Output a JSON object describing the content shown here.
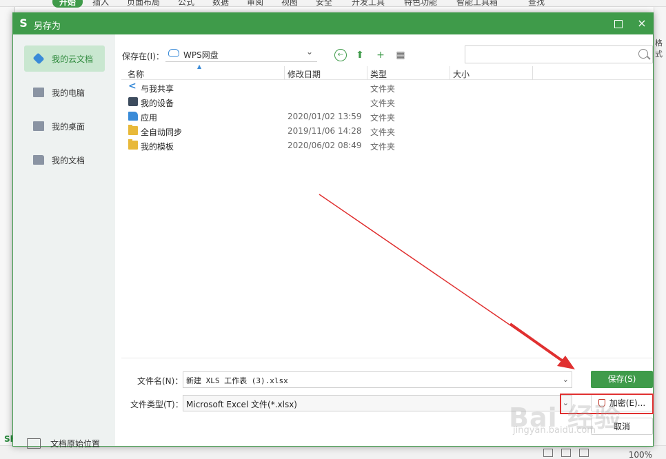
{
  "app": {
    "tabs": [
      "开始",
      "插入",
      "页面布局",
      "公式",
      "数据",
      "审阅",
      "视图",
      "安全",
      "开发工具",
      "特色功能",
      "智能工具箱",
      "查找"
    ],
    "sheet_tab": "Sh",
    "side_label": "格式",
    "zoom": "100%"
  },
  "dialog": {
    "title": "另存为",
    "logo": "S",
    "close": "×",
    "accent_color": "#3f9b4a"
  },
  "sidebar": {
    "items": [
      {
        "label": "我的云文档",
        "icon": "cloud-doc-icon",
        "active": true
      },
      {
        "label": "我的电脑",
        "icon": "computer-icon",
        "active": false
      },
      {
        "label": "我的桌面",
        "icon": "desktop-icon",
        "active": false
      },
      {
        "label": "我的文档",
        "icon": "folder-icon",
        "active": false
      }
    ],
    "bottom": {
      "label": "文档原始位置",
      "icon": "folder-outline-icon"
    }
  },
  "toolbar": {
    "location_label": "保存在(I)：",
    "location_value": "WPS网盘",
    "search_placeholder": ""
  },
  "filelist": {
    "columns": [
      "名称",
      "修改日期",
      "类型",
      "大小"
    ],
    "rows": [
      {
        "name": "与我共享",
        "date": "",
        "type": "文件夹",
        "icon": "share-icon"
      },
      {
        "name": "我的设备",
        "date": "",
        "type": "文件夹",
        "icon": "device-icon"
      },
      {
        "name": "应用",
        "date": "2020/01/02 13:59",
        "type": "文件夹",
        "icon": "app-icon"
      },
      {
        "name": "全自动同步",
        "date": "2019/11/06 14:28",
        "type": "文件夹",
        "icon": "folder-icon"
      },
      {
        "name": "我的模板",
        "date": "2020/06/02 08:49",
        "type": "文件夹",
        "icon": "folder-icon"
      }
    ]
  },
  "form": {
    "filename_label": "文件名(N)：",
    "filename_value": "新建 XLS 工作表 (3).xlsx",
    "filetype_label": "文件类型(T)：",
    "filetype_value": "Microsoft Excel 文件(*.xlsx)",
    "save_label": "保存(S)",
    "encrypt_label": "加密(E)...",
    "cancel_label": "取消"
  },
  "annotation": {
    "watermark": "Bai 经验",
    "watermark_sub": "jingyan.baidu.com",
    "color": "#e03030"
  }
}
